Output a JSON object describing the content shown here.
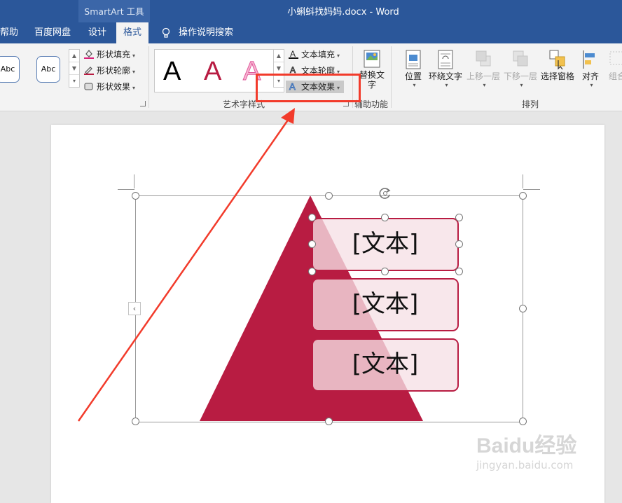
{
  "titlebar": {
    "contextual_label": "SmartArt 工具",
    "document_title": "小蝌蚪找妈妈.docx  -  Word"
  },
  "tabs": [
    {
      "label": "帮助",
      "active": false
    },
    {
      "label": "百度网盘",
      "active": false
    },
    {
      "label": "设计",
      "active": false
    },
    {
      "label": "格式",
      "active": true
    }
  ],
  "tell_me": "操作说明搜索",
  "ribbon": {
    "shape_styles": {
      "abc_1": "Abc",
      "abc_2": "Abc",
      "shape_fill": "形状填充",
      "shape_outline": "形状轮廓",
      "shape_effects": "形状效果"
    },
    "wordart": {
      "sample_letter": "A",
      "text_fill": "文本填充",
      "text_outline": "文本轮廓",
      "text_effects": "文本效果",
      "group_label": "艺术字样式"
    },
    "accessibility": {
      "alt_text": "替换文字",
      "group_label": "辅助功能"
    },
    "arrange": {
      "position": "位置",
      "wrap_text": "环绕文字",
      "bring_forward": "上移一层",
      "send_backward": "下移一层",
      "selection_pane": "选择窗格",
      "align": "对齐",
      "group": "组合",
      "group_label": "排列"
    }
  },
  "smartart": {
    "boxes": [
      "[文本]",
      "[文本]",
      "[文本]"
    ]
  },
  "watermark": {
    "brand": "Baidu经验",
    "url": "jingyan.baidu.com"
  },
  "colors": {
    "title_blue": "#2b579a",
    "pyramid_red": "#b81c42",
    "highlight_red": "#f23b2b"
  }
}
